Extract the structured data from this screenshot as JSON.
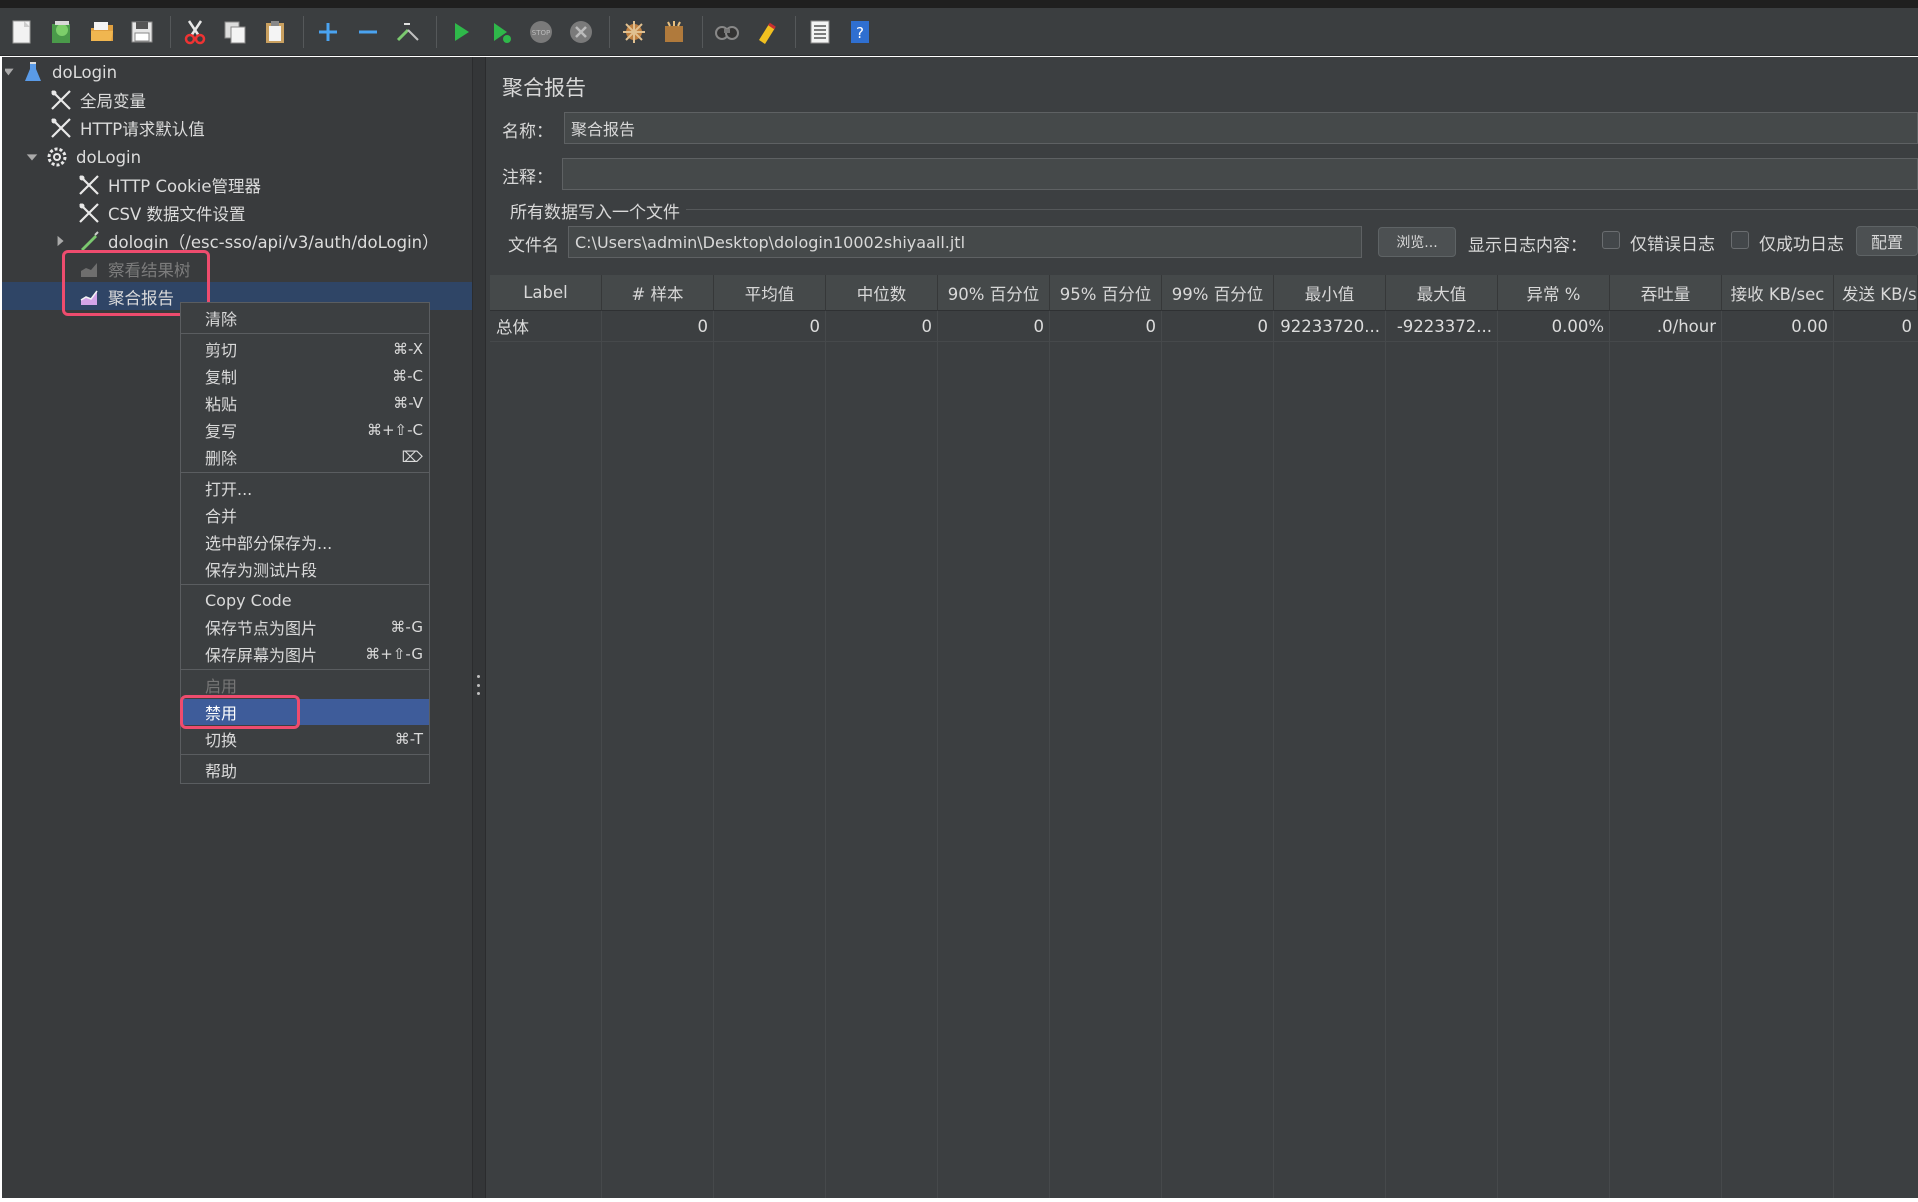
{
  "colors": {
    "highlight_box": "#ee4c6e",
    "selected_row": "#2f4566",
    "active_menu": "#3e5c9a",
    "panel_bg": "#3c3f41"
  },
  "toolbar": {
    "icons": [
      "new-icon",
      "templates-icon",
      "open-icon",
      "save-icon",
      "cut-icon",
      "copy-icon",
      "paste-icon",
      "expand-icon",
      "collapse-icon",
      "toggle-icon",
      "start-icon",
      "start-no-pause-icon",
      "stop-icon",
      "shutdown-icon",
      "clear-icon",
      "clear-all-icon",
      "search-icon",
      "reset-search-icon",
      "function-helper-icon",
      "help-icon"
    ]
  },
  "tree": {
    "root": "doLogin",
    "global_vars": "全局变量",
    "http_defaults": "HTTP请求默认值",
    "thread_group": "doLogin",
    "cookie_manager": "HTTP Cookie管理器",
    "csv_config": "CSV 数据文件设置",
    "sampler": "dologin（/esc-sso/api/v3/auth/doLogin）",
    "view_results_tree": "察看结果树",
    "aggregate_report": "聚合报告"
  },
  "context_menu": {
    "items": [
      {
        "label": "清除",
        "shortcut": ""
      },
      {
        "label": "剪切",
        "shortcut": "⌘-X"
      },
      {
        "label": "复制",
        "shortcut": "⌘-C"
      },
      {
        "label": "粘贴",
        "shortcut": "⌘-V"
      },
      {
        "label": "复写",
        "shortcut": "⌘+⇧-C"
      },
      {
        "label": "删除",
        "shortcut": "⌦"
      },
      {
        "label": "打开...",
        "shortcut": ""
      },
      {
        "label": "合并",
        "shortcut": ""
      },
      {
        "label": "选中部分保存为...",
        "shortcut": ""
      },
      {
        "label": "保存为测试片段",
        "shortcut": ""
      },
      {
        "label": "Copy Code",
        "shortcut": ""
      },
      {
        "label": "保存节点为图片",
        "shortcut": "⌘-G"
      },
      {
        "label": "保存屏幕为图片",
        "shortcut": "⌘+⇧-G"
      },
      {
        "label": "启用",
        "shortcut": ""
      },
      {
        "label": "禁用",
        "shortcut": ""
      },
      {
        "label": "切换",
        "shortcut": "⌘-T"
      },
      {
        "label": "帮助",
        "shortcut": ""
      }
    ]
  },
  "report": {
    "title": "聚合报告",
    "name_label": "名称：",
    "name_value": "聚合报告",
    "comment_label": "注释：",
    "comment_value": "",
    "file_section": "所有数据写入一个文件",
    "filename_label": "文件名",
    "filename_value": "C:\\Users\\admin\\Desktop\\dologin10002shiyaall.jtl",
    "browse_label": "浏览...",
    "log_content_label": "显示日志内容：",
    "errors_only_label": "仅错误日志",
    "success_only_label": "仅成功日志",
    "configure_label": "配置"
  },
  "table": {
    "headers": [
      "Label",
      "# 样本",
      "平均值",
      "中位数",
      "90% 百分位",
      "95% 百分位",
      "99% 百分位",
      "最小值",
      "最大值",
      "异常 %",
      "吞吐量",
      "接收 KB/sec",
      "发送 KB/s"
    ],
    "rows": [
      [
        "总体",
        "0",
        "0",
        "0",
        "0",
        "0",
        "0",
        "92233720...",
        "-9223372...",
        "0.00%",
        ".0/hour",
        "0.00",
        "0"
      ]
    ]
  }
}
